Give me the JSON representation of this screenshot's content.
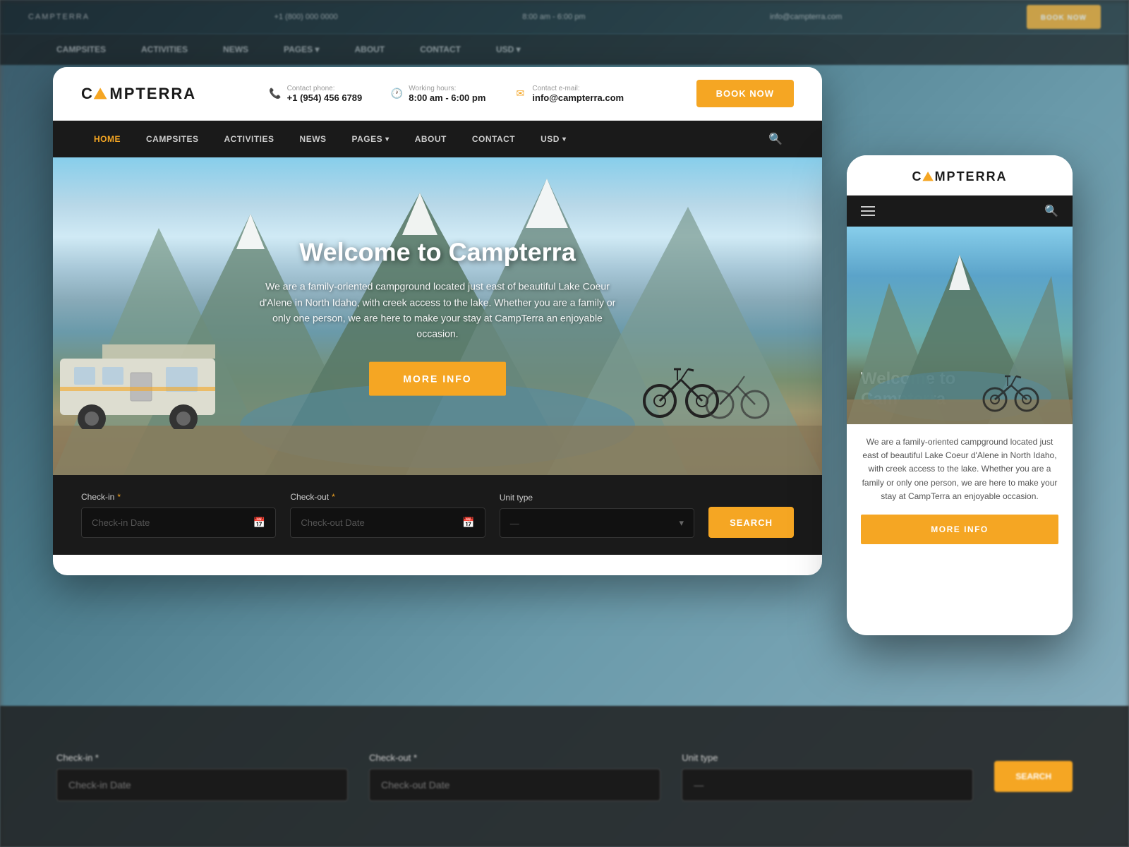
{
  "site": {
    "name": "CAMPTERRA",
    "logo_accent": "A"
  },
  "header": {
    "contact_phone_label": "Contact phone:",
    "contact_phone": "+1 (954) 456 6789",
    "working_hours_label": "Working hours:",
    "working_hours": "8:00 am - 6:00 pm",
    "contact_email_label": "Contact e-mail:",
    "contact_email": "info@campterra.com",
    "book_now": "BOOK NOW"
  },
  "nav": {
    "items": [
      {
        "label": "HOME",
        "active": true
      },
      {
        "label": "CAMPSITES",
        "active": false
      },
      {
        "label": "ACTIVITIES",
        "active": false
      },
      {
        "label": "NEWS",
        "active": false
      },
      {
        "label": "PAGES",
        "active": false,
        "has_dropdown": true
      },
      {
        "label": "ABOUT",
        "active": false
      },
      {
        "label": "CONTACT",
        "active": false
      },
      {
        "label": "USD",
        "active": false,
        "has_dropdown": true
      }
    ]
  },
  "hero": {
    "title": "Welcome to Campterra",
    "description": "We are a family-oriented campground located just east of beautiful Lake Coeur d'Alene in North Idaho, with creek access to the lake. Whether you are a family or only one person, we are here to make your stay at CampTerra an enjoyable occasion.",
    "more_info_btn": "MORE INFO"
  },
  "booking": {
    "checkin_label": "Check-in",
    "checkin_placeholder": "Check-in Date",
    "checkout_label": "Check-out",
    "checkout_placeholder": "Check-out Date",
    "unit_label": "Unit type",
    "unit_placeholder": "—",
    "search_btn": "SEARCH"
  },
  "mobile": {
    "logo": "CAMPTERRA",
    "hero_title": "Welcome to Campterra",
    "description": "We are a family-oriented campground located just east of beautiful Lake Coeur d'Alene in North Idaho, with creek access to the lake. Whether you are a family or only one person, we are here to make your stay at CampTerra an enjoyable occasion.",
    "more_info_btn": "MORE INFO"
  },
  "colors": {
    "accent": "#f5a623",
    "dark": "#1a1a1a",
    "nav_bg": "#222222"
  }
}
